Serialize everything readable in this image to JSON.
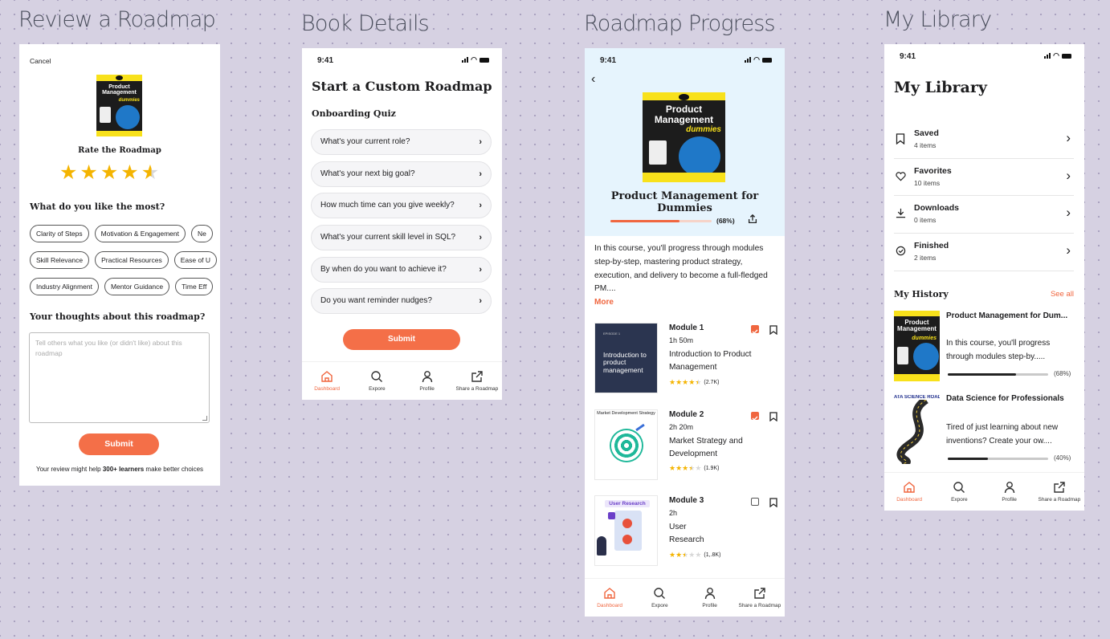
{
  "canvas": {
    "titles": [
      "Review a Roadmap",
      "Book Details",
      "Roadmap Progress",
      "My Library"
    ]
  },
  "colors": {
    "accent": "#f46f48",
    "background": "#d6d1e2",
    "star": "#f4b400",
    "hero_bg": "#e6f4fd"
  },
  "status_time": "9:41",
  "review": {
    "cancel": "Cancel",
    "cover": {
      "title": "Product Management",
      "brand": "dummies"
    },
    "rate_title": "Rate the Roadmap",
    "rating": 4.5,
    "like_title": "What do you like the most?",
    "chips_row1": [
      "Clarity of Steps",
      "Motivation & Engagement",
      "Ne"
    ],
    "chips_row2": [
      "Skill Relevance",
      "Practical Resources",
      "Ease of U"
    ],
    "chips_row3": [
      "Industry Alignment",
      "Mentor Guidance",
      "Time Eff"
    ],
    "thoughts_title": "Your thoughts about this roadmap?",
    "textarea_placeholder": "Tell others what you like (or didn't like) about this roadmap",
    "submit": "Submit",
    "footer_prefix": "Your review might help ",
    "footer_bold": "300+ learners",
    "footer_suffix": " make better choices"
  },
  "book_details": {
    "title": "Start a Custom Roadmap",
    "subtitle": "Onboarding Quiz",
    "questions": [
      "What's your current role?",
      "What's your next big goal?",
      "How much time can you give weekly?",
      "What's your current skill level in SQL?",
      "By when do you want to achieve it?",
      "Do you want reminder nudges?"
    ],
    "submit": "Submit"
  },
  "tabs": [
    "Dashboard",
    "Expore",
    "Profile",
    "Share a Roadmap"
  ],
  "progress": {
    "cover": {
      "title": "Product Management",
      "brand": "dummies"
    },
    "book_title": "Product Management for Dummies",
    "progress_value": 0.68,
    "progress_label": "(68%)",
    "description": "In this course, you'll progress through modules step-by-step, mastering product strategy, execution, and delivery to become a full-fledged PM....",
    "more": "More",
    "modules": [
      {
        "name": "Module 1",
        "duration": "1h 50m",
        "title": "Introduction to Product Management",
        "rating": 4.5,
        "count": "(2.7K)",
        "checked": true,
        "thumb_text": "Introduction to product management",
        "thumb_top": "EPISODE 1"
      },
      {
        "name": "Module 2",
        "duration": "2h 20m",
        "title": "Market Strategy and Development",
        "rating": 3.5,
        "count": "(1.9K)",
        "checked": true,
        "thumb_text": "Market Development Strategy"
      },
      {
        "name": "Module 3",
        "duration": "2h",
        "title": "User Research",
        "rating": 2.5,
        "count": "(1,.8K)",
        "checked": false,
        "thumb_text": "User Research"
      }
    ]
  },
  "library": {
    "title": "My Library",
    "items": [
      {
        "label": "Saved",
        "count": "4 items",
        "icon": "bookmark-icon"
      },
      {
        "label": "Favorites",
        "count": "10 items",
        "icon": "heart-icon"
      },
      {
        "label": "Downloads",
        "count": "0 items",
        "icon": "download-icon"
      },
      {
        "label": "Finished",
        "count": "2 items",
        "icon": "check-circle-icon"
      }
    ],
    "history_title": "My History",
    "see_all": "See all",
    "history": [
      {
        "title": "Product Management for Dum...",
        "desc": "In this course, you'll progress through modules step-by.....",
        "progress_value": 0.68,
        "progress_label": "(68%)",
        "cover_title": "Product Management",
        "cover_brand": "dummies"
      },
      {
        "title": "Data Science for Professionals",
        "desc": "Tired of just learning about new inventions? Create your ow....",
        "progress_value": 0.4,
        "progress_label": "(40%)",
        "cover_header": "ATA SCIENCE ROADMA"
      }
    ]
  }
}
